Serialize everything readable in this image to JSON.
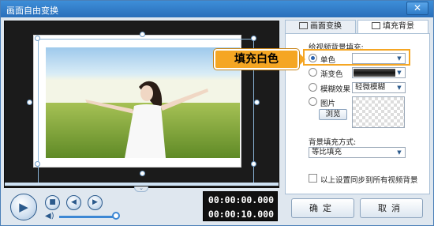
{
  "window": {
    "title": "画面自由变换",
    "close_icon": "close-icon"
  },
  "tabs": [
    {
      "label": "画面变换",
      "icon": "transform-icon",
      "active": false
    },
    {
      "label": "填充背景",
      "icon": "fill-icon",
      "active": true
    }
  ],
  "fill": {
    "section_label": "给视频背景填充:",
    "options": [
      {
        "label": "单色",
        "checked": true
      },
      {
        "label": "渐变色",
        "checked": false
      },
      {
        "label": "模糊效果",
        "checked": false,
        "value": "轻微模糊"
      },
      {
        "label": "图片",
        "checked": false
      }
    ],
    "browse_label": "浏览",
    "mode_label": "背景填充方式:",
    "mode_value": "等比填充",
    "sync_label": "以上设置同步到所有视频背景"
  },
  "callout": {
    "text": "填充白色",
    "color": "#f5a623"
  },
  "player": {
    "current_time": "00:00:00.000",
    "total_time": "00:00:10.000",
    "volume": 0.95,
    "play_icon": "play-icon",
    "stop_icon": "stop-icon",
    "prev_icon": "prev-frame-icon",
    "next_icon": "next-frame-icon",
    "volume_icon": "volume-icon"
  },
  "footer": {
    "ok_label": "确定",
    "cancel_label": "取消"
  },
  "colors": {
    "accent": "#3c87d4",
    "title_bar": "#2a6fba",
    "highlight": "#f5a623"
  }
}
